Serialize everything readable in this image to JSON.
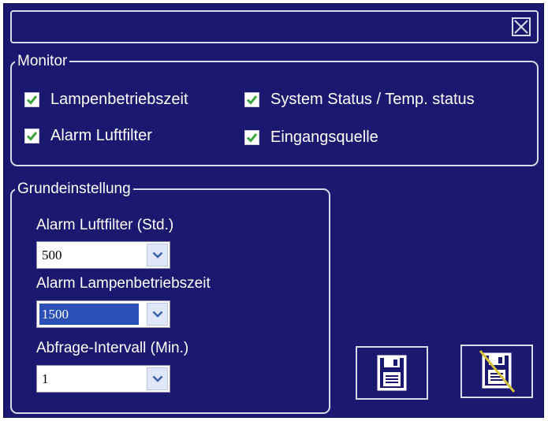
{
  "monitor": {
    "legend": "Monitor",
    "items": [
      {
        "label": "Lampenbetriebszeit",
        "checked": true
      },
      {
        "label": "Alarm Luftfilter",
        "checked": true
      },
      {
        "label": "System Status / Temp. status",
        "checked": true
      },
      {
        "label": "Eingangsquelle",
        "checked": true
      }
    ]
  },
  "grund": {
    "legend": "Grundeinstellung",
    "fields": [
      {
        "label": "Alarm Luftfilter (Std.)",
        "value": "500"
      },
      {
        "label": "Alarm Lampenbetriebszeit",
        "value": "1500"
      },
      {
        "label": "Abfrage-Intervall (Min.)",
        "value": "1"
      }
    ]
  },
  "icons": {
    "close": "close-icon",
    "save": "floppy-disk-icon",
    "discard": "floppy-disk-crossed-icon"
  },
  "colors": {
    "background": "#1b1870",
    "border": "#d9dbe8",
    "check": "#3ca43c",
    "selection": "#2a4fb5",
    "strike": "#d9c23a"
  }
}
